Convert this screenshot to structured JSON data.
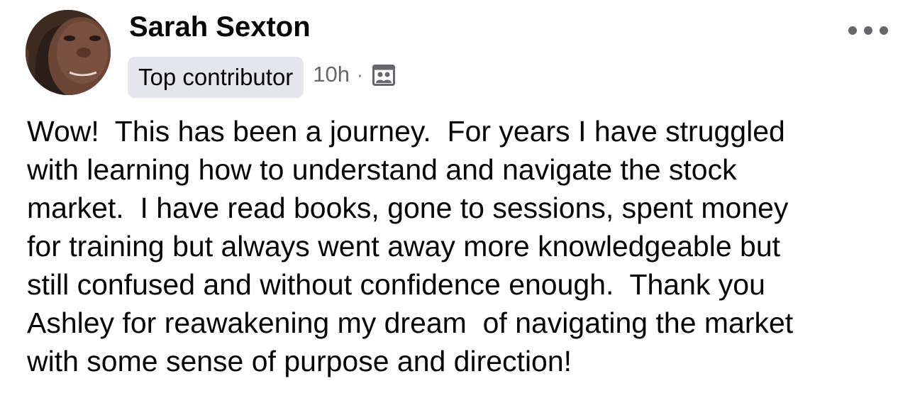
{
  "post": {
    "author": {
      "name": "Sarah Sexton",
      "badge": "Top contributor"
    },
    "timestamp": "10h",
    "separator": "·",
    "audience_icon": "group-audience-icon",
    "menu_icon": "more-options-icon",
    "body": "Wow!  This has been a journey.  For years I have struggled\nwith learning how to understand and navigate the stock\nmarket.  I have read books, gone to sessions, spent money\nfor training but always went away more knowledgeable but\nstill confused and without confidence enough.  Thank you\nAshley for reawakening my dream  of navigating the market\nwith some sense of purpose and direction!"
  },
  "colors": {
    "text_primary": "#050505",
    "text_secondary": "#65676b",
    "badge_background": "#e4e6eb"
  }
}
